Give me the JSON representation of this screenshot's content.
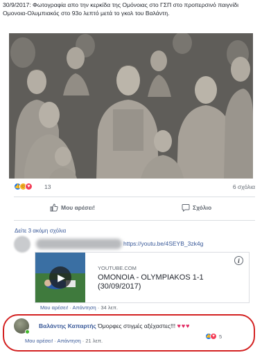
{
  "post": {
    "caption": "30/9/2017: Φωτογραφία απο την κερκίδα της Ομόνοιας στο ΓΣΠ στο προπερσινό παιγνίδι Ομονοια-Ολυμπιακός στο 93ο λεπτό μετά το γκολ του Βαλάντη."
  },
  "reactions": {
    "icons": [
      "like-icon",
      "haha-icon",
      "love-icon"
    ],
    "count": "13",
    "comments_count": "6 σχόλια"
  },
  "actions": {
    "like_label": "Μου αρέσει!",
    "comment_label": "Σχόλιο"
  },
  "comments": {
    "more_label": "Δείτε 3 ακόμη σχόλια",
    "first": {
      "link_text": "https://youtu.be/4SEYB_3zk4g",
      "preview": {
        "source": "YOUTUBE.COM",
        "title": "ΟΜΟΝΟΙΑ - OLYMPIAKOS 1-1 (30/09/2017)",
        "info_glyph": "i"
      },
      "like_label": "Μου αρέσει!",
      "reply_label": "Απάντηση",
      "sep": "·",
      "time": "34 λεπ."
    },
    "second": {
      "author": "Βαλάντης Καπαρτής",
      "text": "Όμορφες στιγμές αξέχαστες!!!",
      "emoji": "♥♥♥",
      "like_label": "Μου αρέσει!",
      "reply_label": "Απάντηση",
      "sep": "·",
      "time": "21 λεπ.",
      "reaction_count": "5"
    }
  },
  "colors": {
    "link": "#385898",
    "highlight": "#d32020",
    "like_blue": "#1877f2",
    "heart": "#e0245e"
  }
}
